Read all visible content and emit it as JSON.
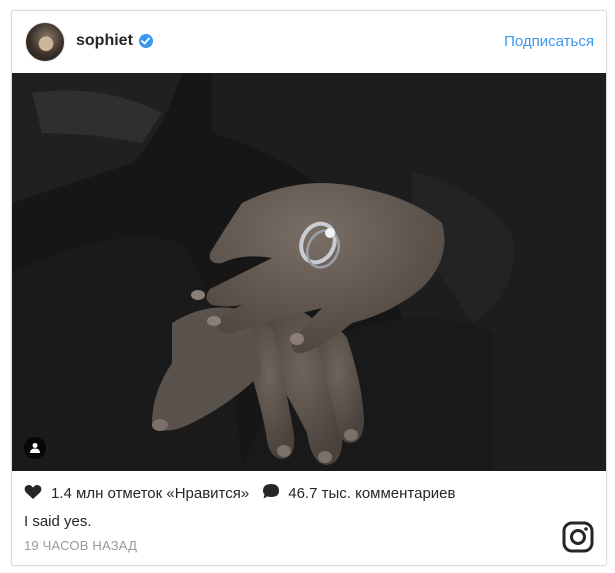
{
  "post": {
    "author": {
      "username": "sophiet",
      "verified": true,
      "avatar_icon": "profile-avatar"
    },
    "follow_label": "Подписаться",
    "image_alt_icon": "user-tag-icon",
    "likes_text": "1.4 млн отметок «Нравится»",
    "comments_text": "46.7 тыс. комментариев",
    "caption": "I said yes.",
    "timestamp": "19 ЧАСОВ НАЗАД",
    "brand_icon": "instagram-logo-icon"
  },
  "colors": {
    "accent": "#3897f0",
    "text": "#262626",
    "muted": "#999999",
    "border": "#dbdbdb"
  }
}
